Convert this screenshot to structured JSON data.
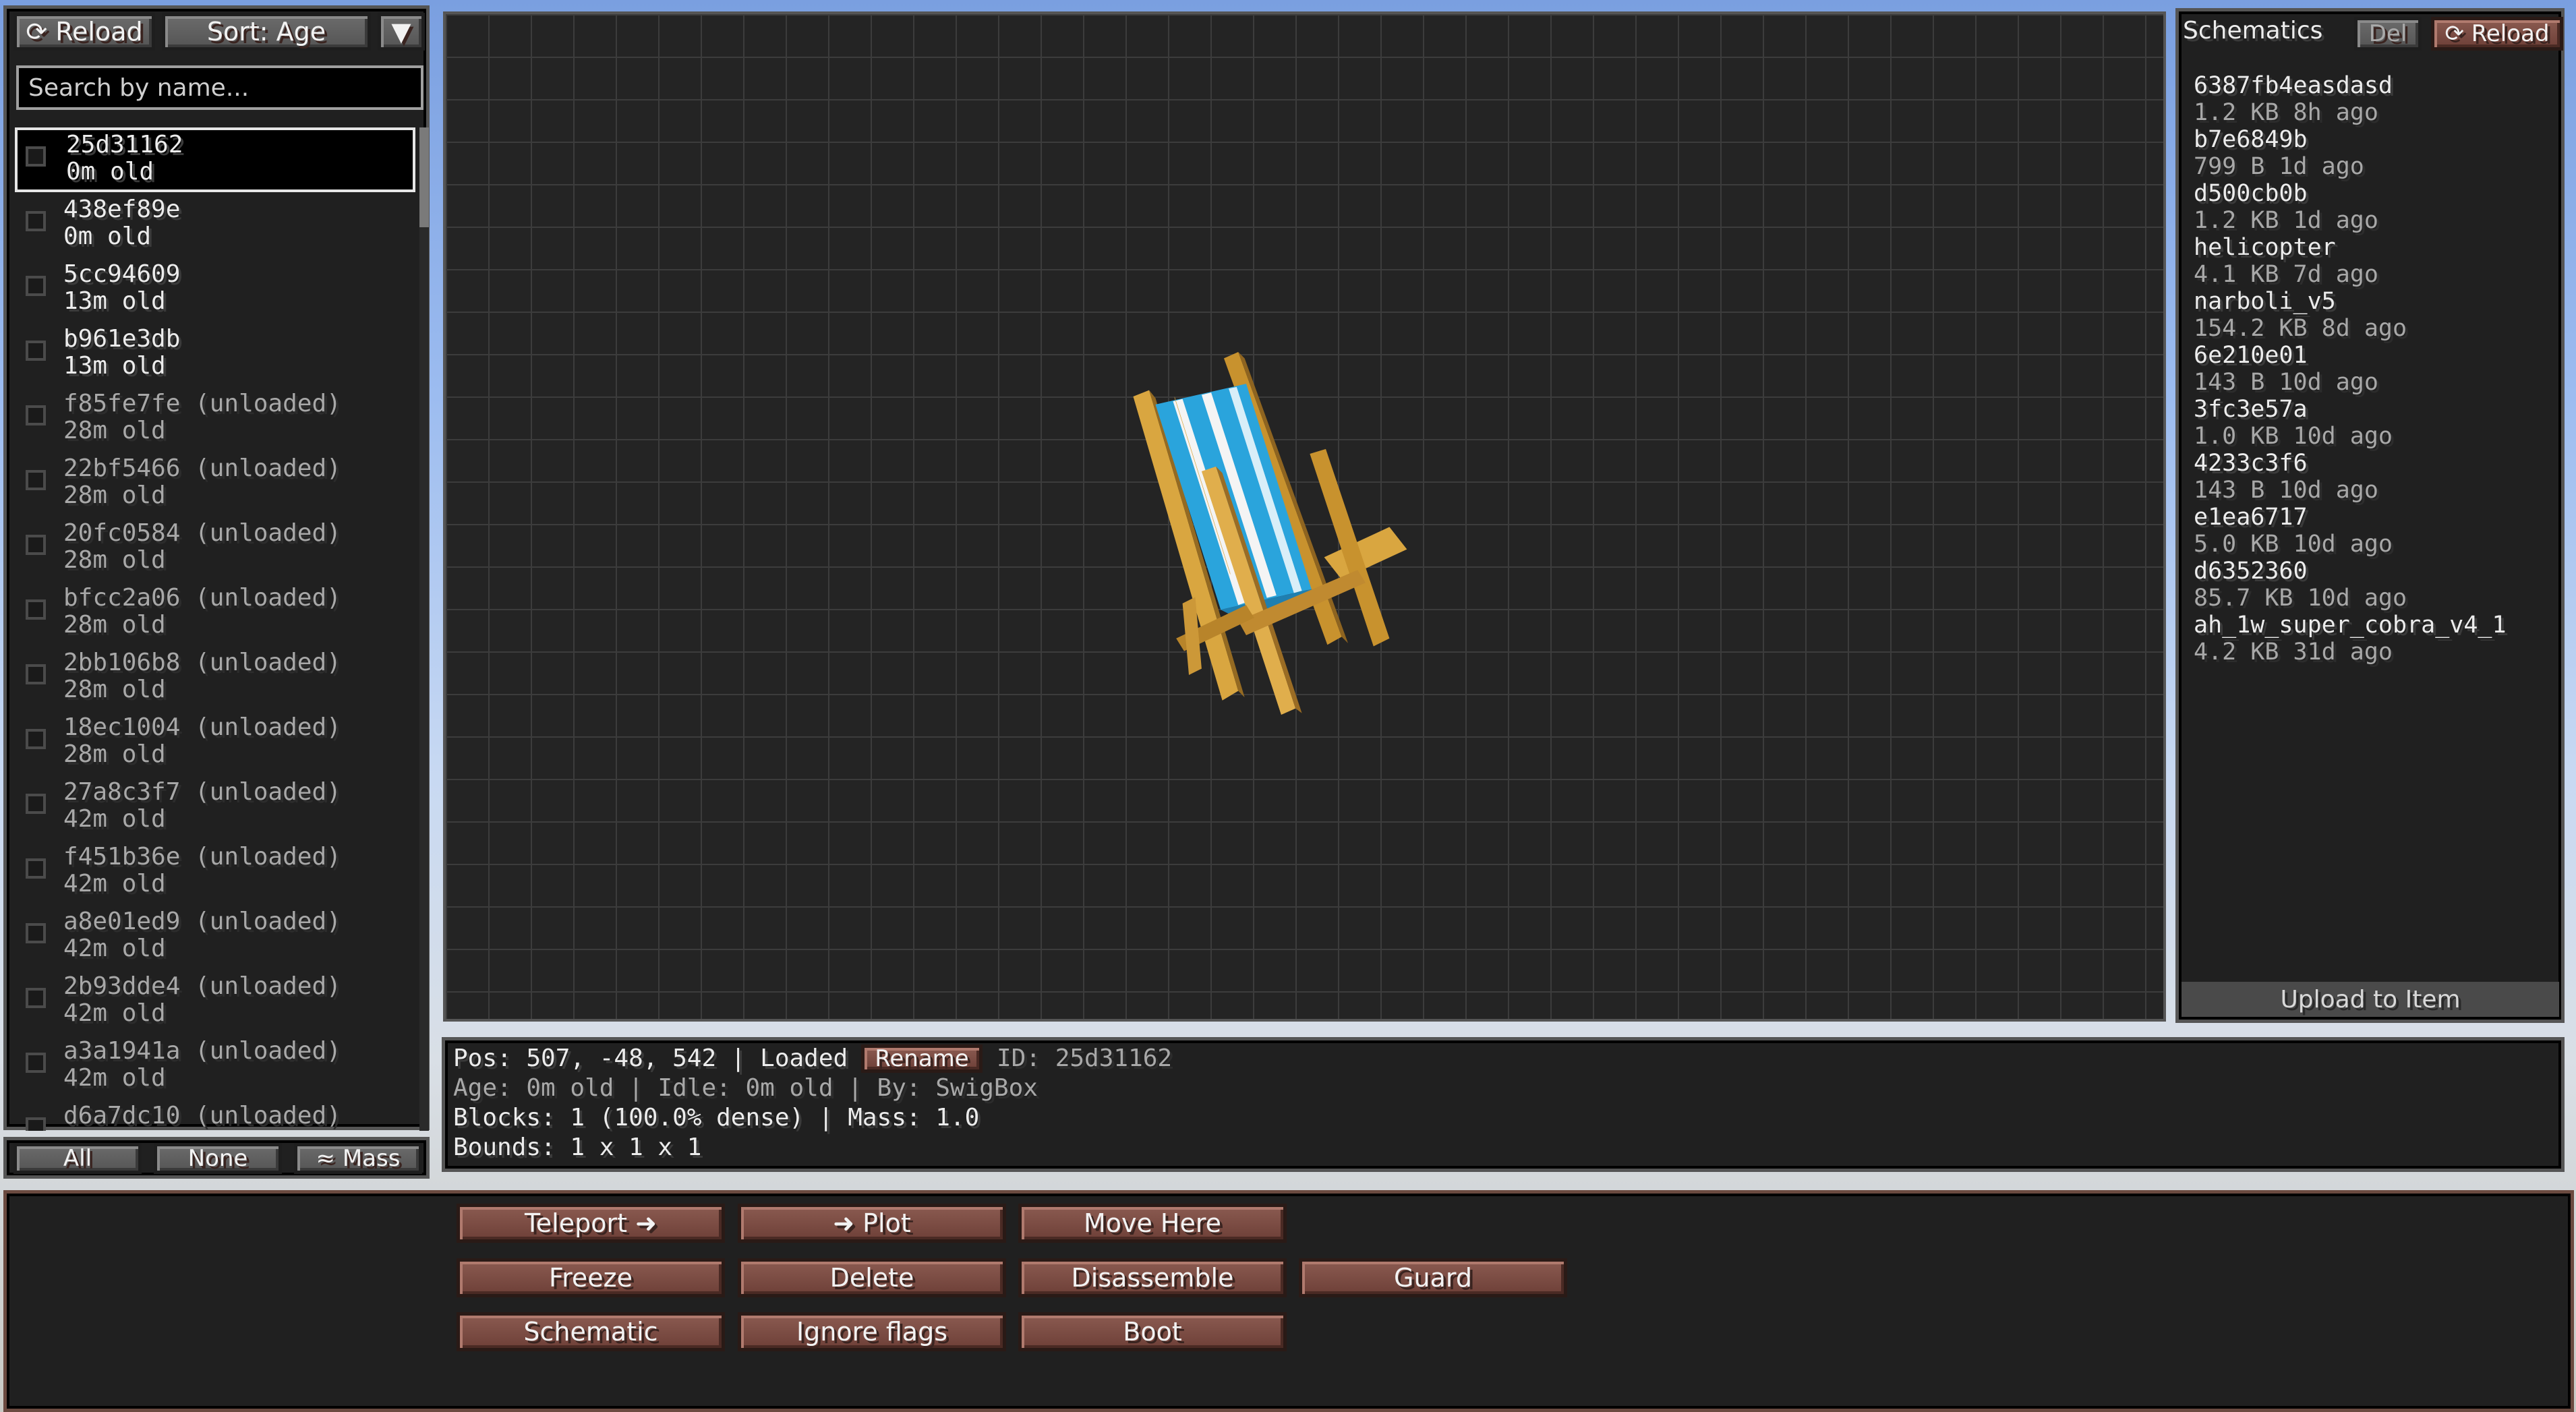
{
  "toolbar": {
    "reload": "⟳ Reload",
    "sort": "Sort: Age",
    "sort_arrow": "▼"
  },
  "search": {
    "placeholder": "Search by name..."
  },
  "entities": [
    {
      "name": "25d31162",
      "age": "0m old",
      "loaded": true,
      "selected": true
    },
    {
      "name": "438ef89e",
      "age": "0m old",
      "loaded": true
    },
    {
      "name": "5cc94609",
      "age": "13m old",
      "loaded": true
    },
    {
      "name": "b961e3db",
      "age": "13m old",
      "loaded": true
    },
    {
      "name": "f85fe7fe (unloaded)",
      "age": "28m old",
      "loaded": false
    },
    {
      "name": "22bf5466 (unloaded)",
      "age": "28m old",
      "loaded": false
    },
    {
      "name": "20fc0584 (unloaded)",
      "age": "28m old",
      "loaded": false
    },
    {
      "name": "bfcc2a06 (unloaded)",
      "age": "28m old",
      "loaded": false
    },
    {
      "name": "2bb106b8 (unloaded)",
      "age": "28m old",
      "loaded": false
    },
    {
      "name": "18ec1004 (unloaded)",
      "age": "28m old",
      "loaded": false
    },
    {
      "name": "27a8c3f7 (unloaded)",
      "age": "42m old",
      "loaded": false
    },
    {
      "name": "f451b36e (unloaded)",
      "age": "42m old",
      "loaded": false
    },
    {
      "name": "a8e01ed9 (unloaded)",
      "age": "42m old",
      "loaded": false
    },
    {
      "name": "2b93dde4 (unloaded)",
      "age": "42m old",
      "loaded": false
    },
    {
      "name": "a3a1941a (unloaded)",
      "age": "42m old",
      "loaded": false
    },
    {
      "name": "d6a7dc10 (unloaded)",
      "age": "",
      "loaded": false
    }
  ],
  "selection": {
    "all": "All",
    "none": "None",
    "mass": "≈ Mass"
  },
  "schematics": {
    "tab": "Schematics",
    "del": "Del",
    "reload": "⟳ Reload",
    "items": [
      {
        "name": "6387fb4easdasd",
        "meta": "1.2 KB  8h ago"
      },
      {
        "name": "b7e6849b",
        "meta": "799 B  1d ago"
      },
      {
        "name": "d500cb0b",
        "meta": "1.2 KB  1d ago"
      },
      {
        "name": "helicopter",
        "meta": "4.1 KB  7d ago"
      },
      {
        "name": "narboli_v5",
        "meta": "154.2 KB  8d ago"
      },
      {
        "name": "6e210e01",
        "meta": "143 B  10d ago"
      },
      {
        "name": "3fc3e57a",
        "meta": "1.0 KB  10d ago"
      },
      {
        "name": "4233c3f6",
        "meta": "143 B  10d ago"
      },
      {
        "name": "e1ea6717",
        "meta": "5.0 KB  10d ago"
      },
      {
        "name": "d6352360",
        "meta": "85.7 KB  10d ago"
      },
      {
        "name": "ah_1w_super_cobra_v4_1",
        "meta": "4.2 KB  31d ago"
      }
    ],
    "upload": "Upload to Item"
  },
  "info": {
    "pos": "Pos: 507, -48, 542  |  Loaded",
    "rename": "Rename",
    "id": "ID: 25d31162",
    "line2": "Age: 0m old  |  Idle: 0m old  |  By: SwigBox",
    "line3": "Blocks: 1  (100.0% dense)  |  Mass: 1.0",
    "line4": "Bounds: 1 x 1 x 1"
  },
  "actions": {
    "teleport": "Teleport ➜",
    "plot": "➜ Plot",
    "move_here": "Move Here",
    "freeze": "Freeze",
    "delete": "Delete",
    "disassemble": "Disassemble",
    "guard": "Guard",
    "schematic": "Schematic",
    "ignore_flags": "Ignore flags",
    "boot": "Boot"
  },
  "colors": {
    "button": "#7a4a42",
    "panel": "#202020",
    "stripe_blue": "#2aa4dc",
    "frame_wood": "#d4a247"
  }
}
